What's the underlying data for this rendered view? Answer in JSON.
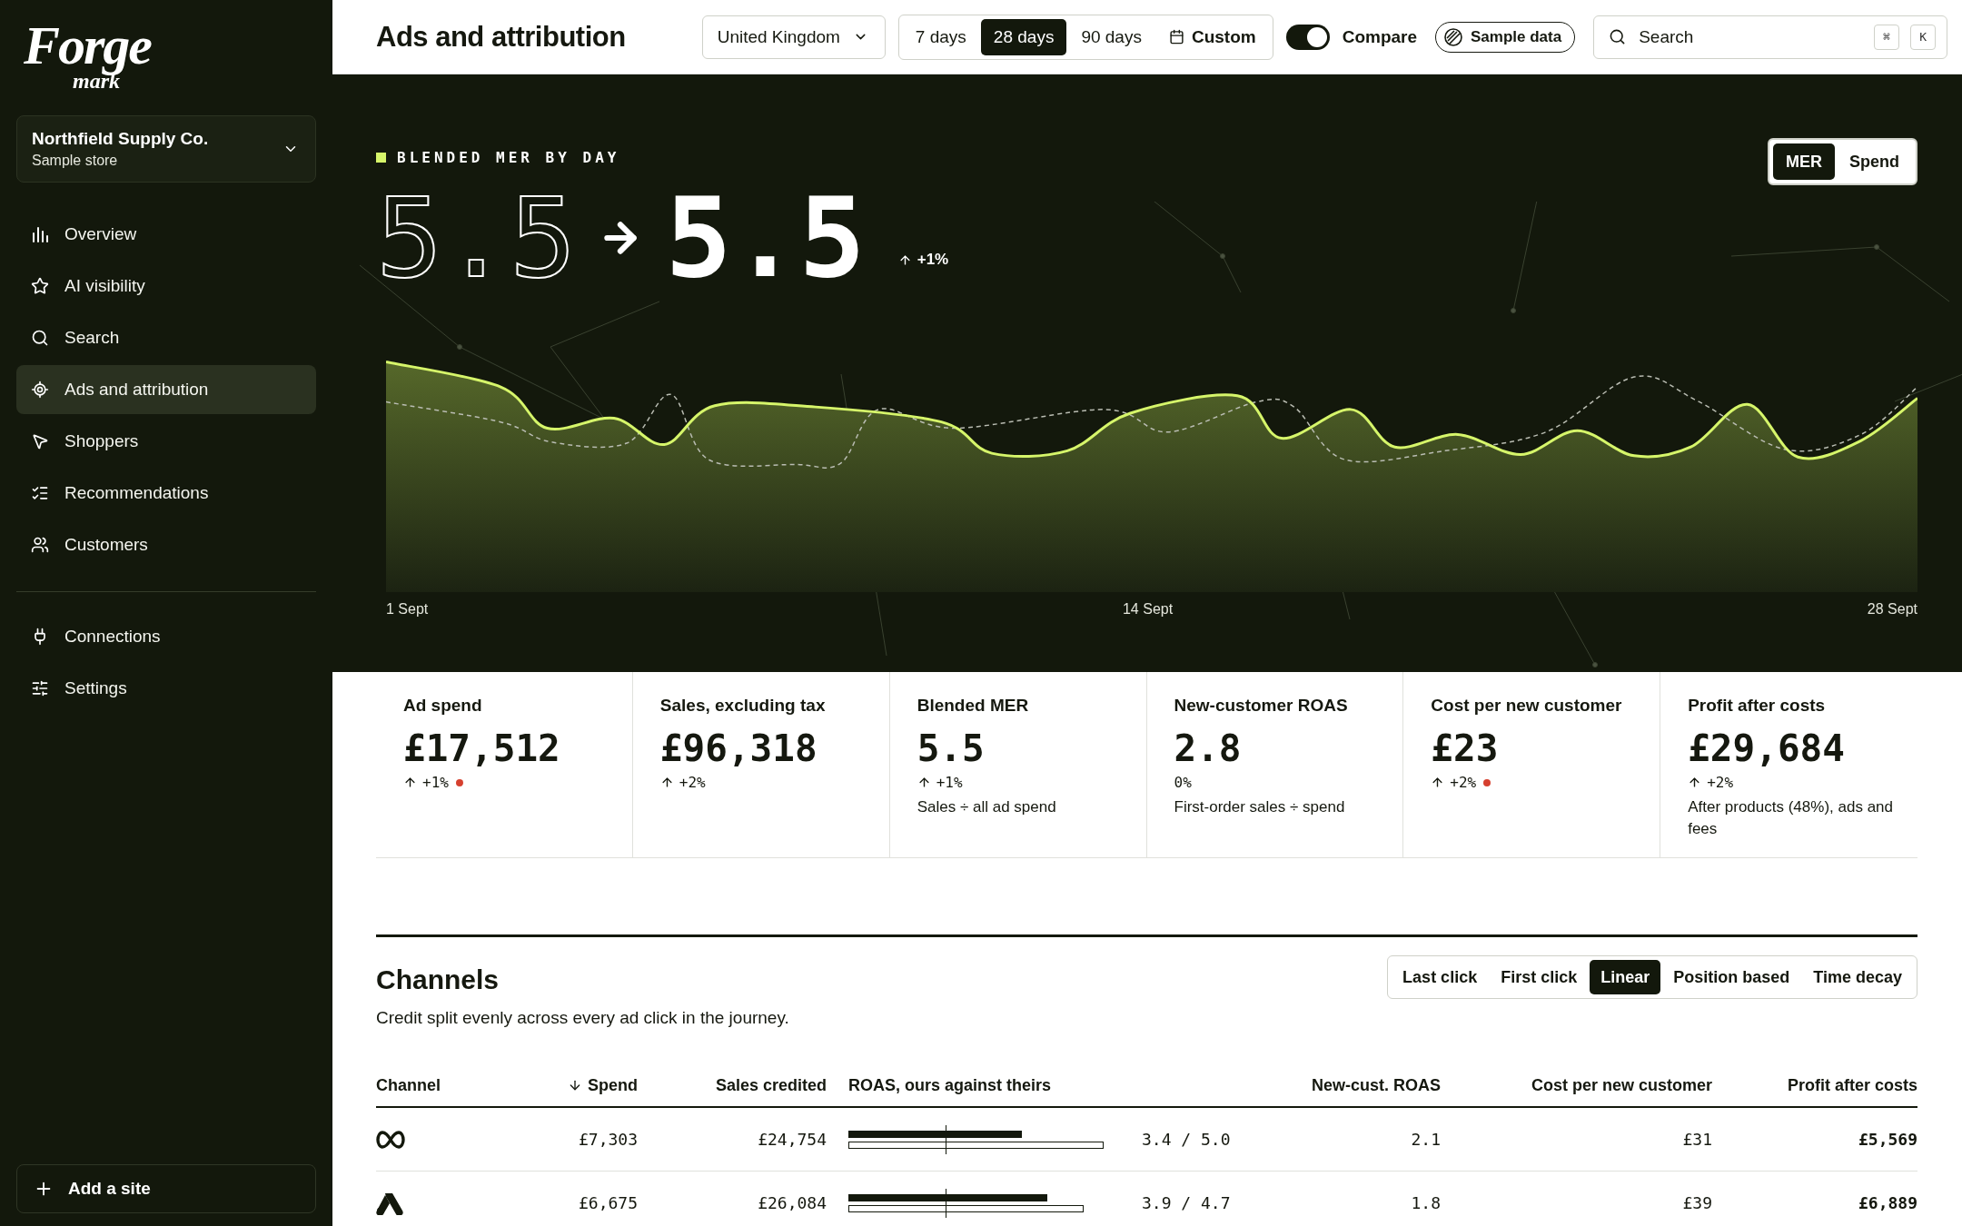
{
  "brand": {
    "name": "Forge",
    "sub": "mark"
  },
  "store": {
    "name": "Northfield Supply Co.",
    "subtitle": "Sample store"
  },
  "nav": [
    {
      "label": "Overview",
      "selected": false
    },
    {
      "label": "AI visibility",
      "selected": false
    },
    {
      "label": "Search",
      "selected": false
    },
    {
      "label": "Ads and attribution",
      "selected": true
    },
    {
      "label": "Shoppers",
      "selected": false
    },
    {
      "label": "Recommendations",
      "selected": false
    },
    {
      "label": "Customers",
      "selected": false
    }
  ],
  "nav_secondary": [
    {
      "label": "Connections",
      "selected": false
    },
    {
      "label": "Settings",
      "selected": false
    }
  ],
  "add_site": "Add a site",
  "header": {
    "title": "Ads and attribution",
    "region": "United Kingdom",
    "ranges": [
      {
        "label": "7 days",
        "selected": false
      },
      {
        "label": "28 days",
        "selected": true
      },
      {
        "label": "90 days",
        "selected": false
      }
    ],
    "custom": "Custom",
    "compare": {
      "label": "Compare",
      "on": true
    },
    "sample_badge": "Sample data",
    "search": {
      "placeholder": "Search",
      "keys": [
        "⌘",
        "K"
      ]
    }
  },
  "hero": {
    "label": "BLENDED MER BY DAY",
    "metric_toggle": [
      {
        "label": "MER",
        "selected": true
      },
      {
        "label": "Spend",
        "selected": false
      }
    ],
    "previous": "5.5",
    "current": "5.5",
    "change": "+1%",
    "rising": true,
    "axis_labels": [
      "1 Sept",
      "14 Sept",
      "28 Sept"
    ]
  },
  "kpis": [
    {
      "label": "Ad spend",
      "value": "£17,512",
      "change": "+1%",
      "rising": true,
      "alert": true
    },
    {
      "label": "Sales, excluding tax",
      "value": "£96,318",
      "change": "+2%",
      "rising": true,
      "alert": false
    },
    {
      "label": "Blended MER",
      "value": "5.5",
      "change": "+1%",
      "rising": true,
      "alert": false,
      "note": "Sales ÷ all ad spend"
    },
    {
      "label": "New-customer ROAS",
      "value": "2.8",
      "change": "0%",
      "rising": false,
      "alert": false,
      "note": "First-order sales ÷ spend"
    },
    {
      "label": "Cost per new customer",
      "value": "£23",
      "change": "+2%",
      "rising": true,
      "alert": true
    },
    {
      "label": "Profit after costs",
      "value": "£29,684",
      "change": "+2%",
      "rising": true,
      "alert": false,
      "note": "After products (48%), ads and fees"
    }
  ],
  "channels": {
    "title": "Channels",
    "description": "Credit split evenly across every ad click in the journey.",
    "models": [
      {
        "label": "Last click",
        "selected": false
      },
      {
        "label": "First click",
        "selected": false
      },
      {
        "label": "Linear",
        "selected": true
      },
      {
        "label": "Position based",
        "selected": false
      },
      {
        "label": "Time decay",
        "selected": false
      }
    ],
    "columns": [
      {
        "label": "Channel",
        "sorted": false
      },
      {
        "label": "Spend",
        "sorted": true
      },
      {
        "label": "Sales credited",
        "sorted": false
      },
      {
        "label": "ROAS, ours against theirs",
        "sorted": false
      },
      {
        "label": "New-cust. ROAS",
        "sorted": false
      },
      {
        "label": "Cost per new customer",
        "sorted": false
      },
      {
        "label": "Profit after costs",
        "sorted": false
      }
    ],
    "rows": [
      {
        "kind": "loop",
        "spend": "£7,303",
        "sales": "£24,754",
        "ours": {
          "level": 0.68
        },
        "theirs": {
          "level": 1.0
        },
        "roas": "3.4 / 5.0",
        "new_roas": "2.1",
        "cost": "£31",
        "profit": "£5,569"
      },
      {
        "kind": "peak",
        "spend": "£6,675",
        "sales": "£26,084",
        "ours": {
          "level": 0.78
        },
        "theirs": {
          "level": 0.92
        },
        "roas": "3.9 / 4.7",
        "new_roas": "1.8",
        "cost": "£39",
        "profit": "£6,889"
      }
    ]
  }
}
